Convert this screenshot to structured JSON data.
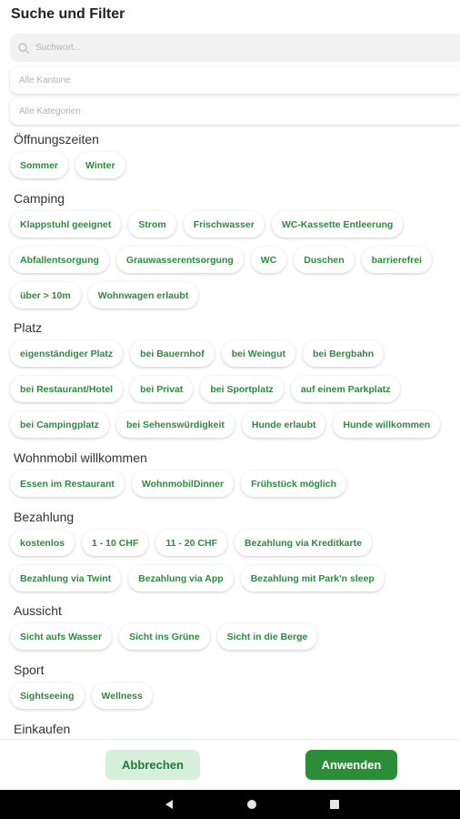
{
  "header": {
    "title": "Suche und Filter"
  },
  "search": {
    "placeholder": "Suchwort...",
    "icon": "search-icon"
  },
  "dropdowns": {
    "kanton": "Alle Kantone",
    "kategorie": "Alle Kategorien"
  },
  "sections": [
    {
      "id": "oeffnungszeiten",
      "title": "Öffnungszeiten",
      "chips": [
        "Sommer",
        "Winter"
      ]
    },
    {
      "id": "camping",
      "title": "Camping",
      "chips": [
        "Klappstuhl geeignet",
        "Strom",
        "Frischwasser",
        "WC-Kassette Entleerung",
        "Abfallentsorgung",
        "Grauwasserentsorgung",
        "WC",
        "Duschen",
        "barrierefrei",
        "über > 10m",
        "Wohnwagen erlaubt"
      ]
    },
    {
      "id": "platz",
      "title": "Platz",
      "chips": [
        "eigenständiger Platz",
        "bei Bauernhof",
        "bei Weingut",
        "bei Bergbahn",
        "bei Restaurant/Hotel",
        "bei Privat",
        "bei Sportplatz",
        "auf einem Parkplatz",
        "bei Campingplatz",
        "bei Sehenswürdigkeit",
        "Hunde erlaubt",
        "Hunde willkommen"
      ]
    },
    {
      "id": "wohnmobil",
      "title": "Wohnmobil willkommen",
      "chips": [
        "Essen im Restaurant",
        "WohnmobilDinner",
        "Frühstück möglich"
      ]
    },
    {
      "id": "bezahlung",
      "title": "Bezahlung",
      "chips": [
        "kostenlos",
        "1 - 10 CHF",
        "11 - 20 CHF",
        "Bezahlung via Kreditkarte",
        "Bezahlung via Twint",
        "Bezahlung via App",
        "Bezahlung mit Park'n sleep"
      ]
    },
    {
      "id": "aussicht",
      "title": "Aussicht",
      "chips": [
        "Sicht aufs Wasser",
        "Sicht ins Grüne",
        "Sicht in die Berge"
      ]
    },
    {
      "id": "sport",
      "title": "Sport",
      "chips": [
        "Sightseeing",
        "Wellness"
      ]
    },
    {
      "id": "einkaufen",
      "title": "Einkaufen",
      "chips": []
    }
  ],
  "footer": {
    "cancel_label": "Abbrechen",
    "apply_label": "Anwenden"
  },
  "nav": {
    "back_icon": "back-triangle-icon",
    "home_icon": "home-circle-icon",
    "recents_icon": "recents-square-icon"
  },
  "colors": {
    "accent": "#2b8d38",
    "chip_text": "#2e8b3e",
    "cancel_bg": "#d7f0dc"
  }
}
